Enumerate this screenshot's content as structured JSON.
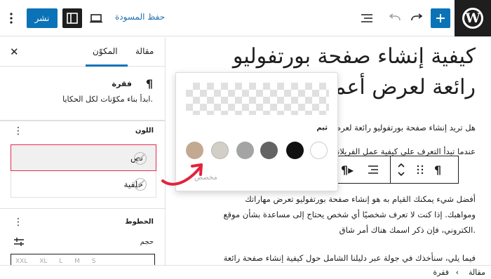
{
  "toolbar": {
    "logo": "W",
    "save_draft": "حفظ المسودة",
    "publish": "نشر",
    "icons": [
      "wordpress-logo",
      "plus-icon",
      "redo-icon",
      "undo-icon",
      "list-view-icon",
      "desktop-preview-icon",
      "settings-panel-icon",
      "more-vertical-icon"
    ]
  },
  "sidebar": {
    "tabs": [
      "مقالة",
      "المكوّن"
    ],
    "active_tab": "المكوّن",
    "block": {
      "icon": "¶",
      "title": "فقرة",
      "description": "ابدأ بناء مكوّنات لكل الحكايا."
    },
    "color": {
      "title": "اللون",
      "items": [
        {
          "label": "نص"
        },
        {
          "label": "خلفية"
        }
      ]
    },
    "typography": {
      "title": "الخطوط",
      "size_label": "حجم",
      "size_options": "XXL XL L M S"
    }
  },
  "editor": {
    "title": "كيفية إنشاء صفحة بورتفوليو رائعة لعرض أعمالك",
    "paragraphs": [
      "هل تريد إنشاء صفحة بورتفوليو رائعة لعرض أعمالك؟",
      "عندما تبدأ التعرف على كيفية عمل الفريلانسر أو المصممين",
      "أفضل شيء يمكنك القيام به هو إنشاء صفحة بورتفوليو تعرض مهاراتك",
      "ومواهبك. إذا كنت لا تعرف شخصيًا أي شخص يحتاج إلى مساعدة بشأن موقع",
      "الكتروني، فإن ذكر اسمك هناك أمر شاق.",
      "فيما يلي، سنأخذك في جولة عبر دليلنا الشامل حول كيفية إنشاء صفحة رائعة"
    ]
  },
  "color_popover": {
    "theme_label": "ثيم",
    "custom_label": "مخصص",
    "palette": [
      "#ffffff",
      "#111111",
      "#636363",
      "#a4a4a4",
      "#d1cfc7",
      "#c2a990"
    ]
  },
  "breadcrumb": [
    "مقالة",
    "فقرة"
  ]
}
